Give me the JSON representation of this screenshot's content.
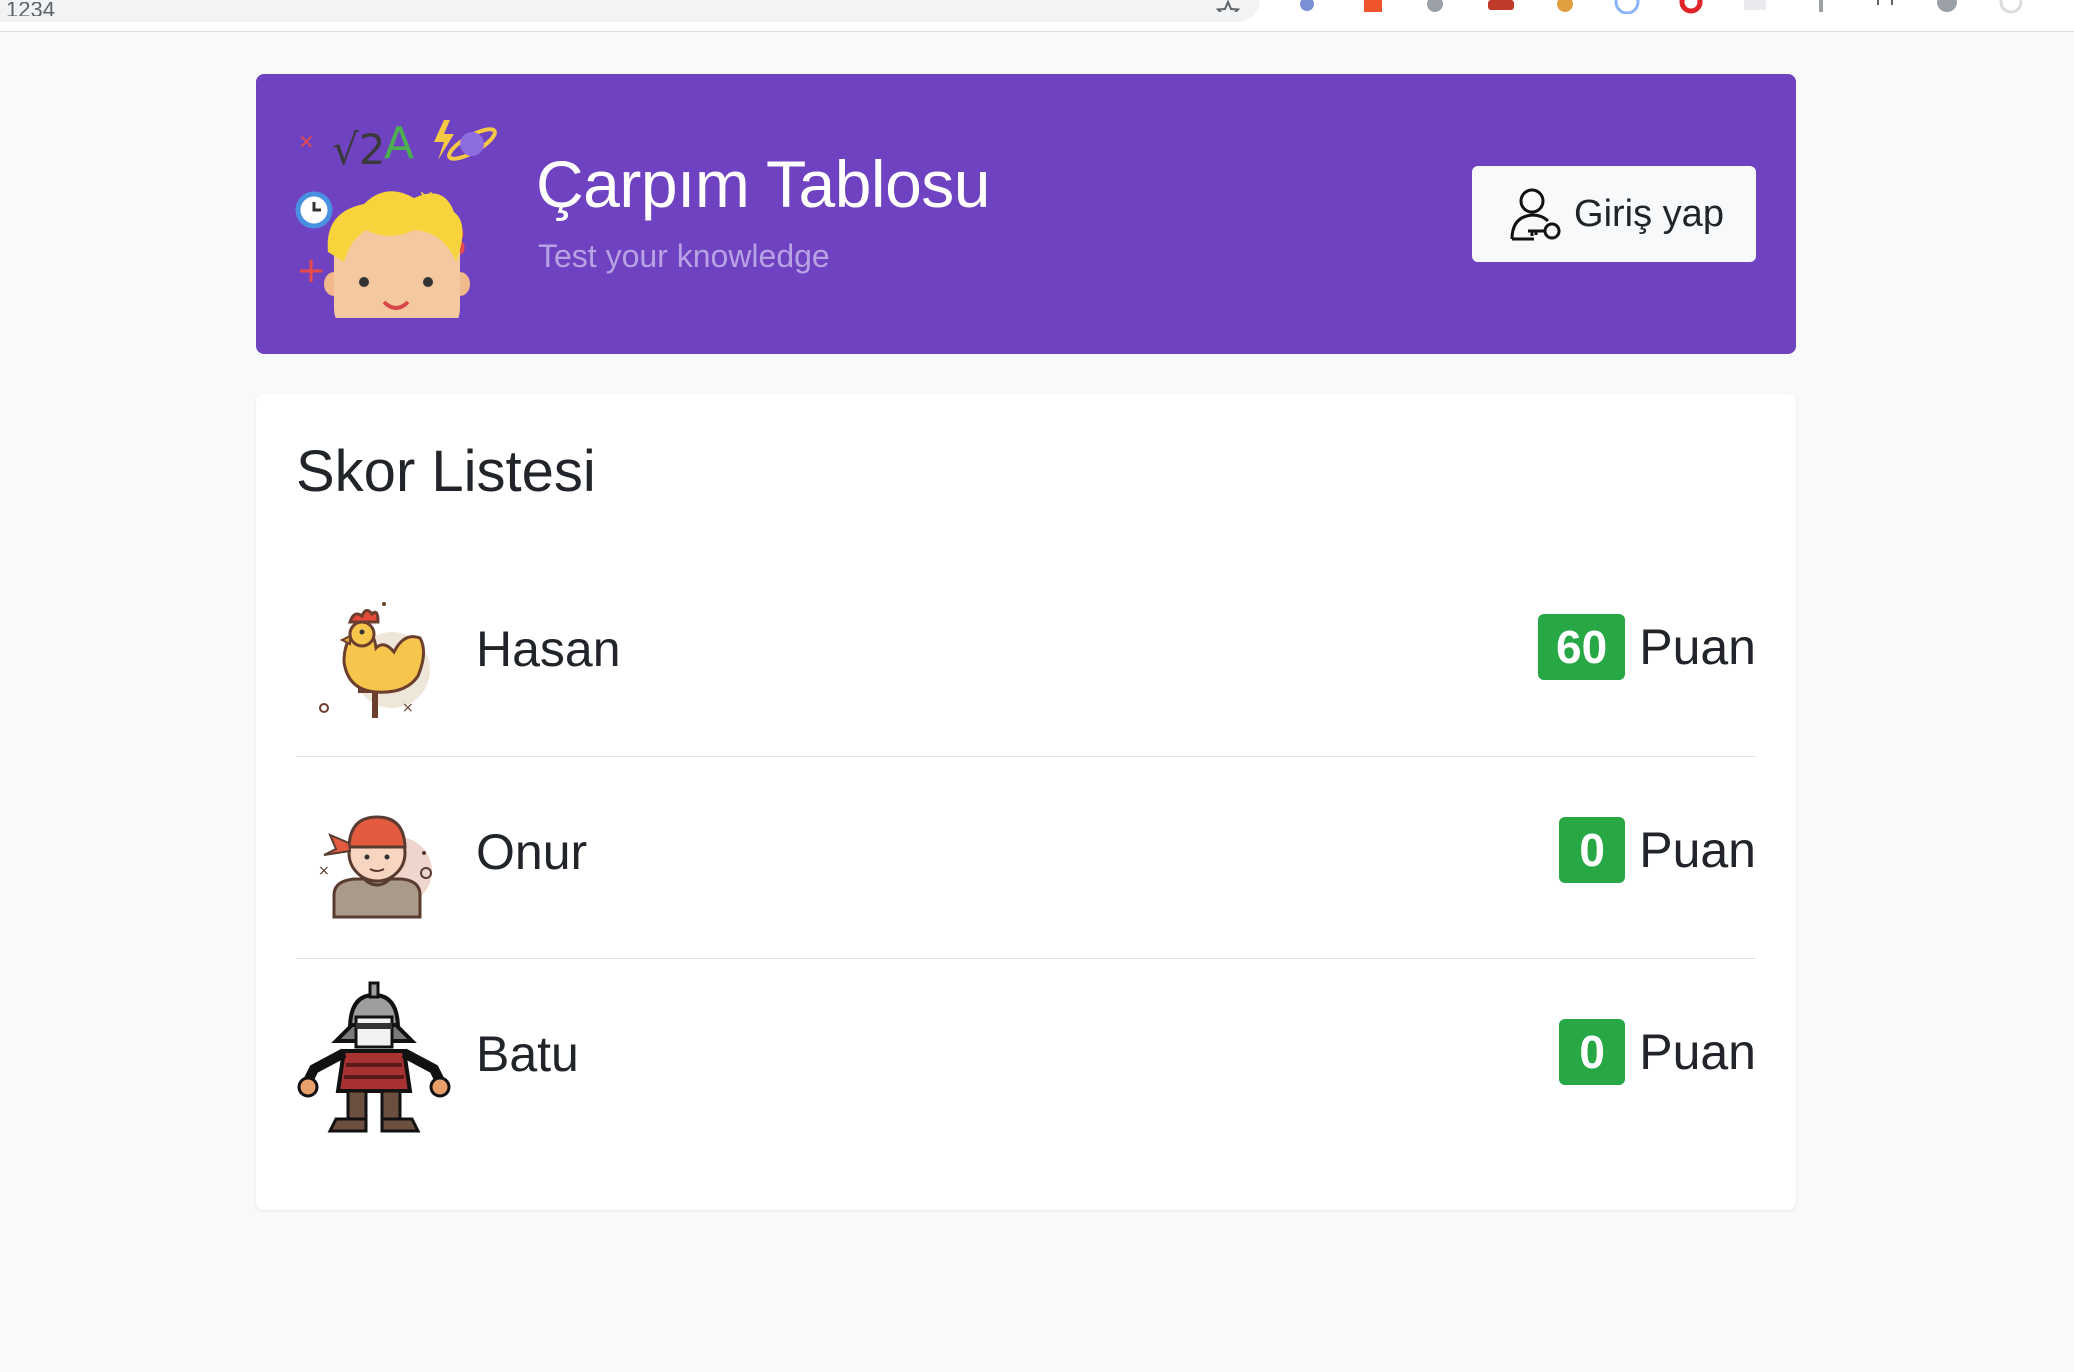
{
  "browser": {
    "url_fragment": "1234"
  },
  "header": {
    "title": "Çarpım Tablosu",
    "subtitle": "Test your knowledge",
    "login_label": "Giriş yap",
    "background_color": "#6f42c1"
  },
  "scoreboard": {
    "title": "Skor Listesi",
    "unit_label": "Puan",
    "badge_color": "#28a745",
    "players": [
      {
        "name": "Hasan",
        "score": "60",
        "avatar_icon": "rooster-icon"
      },
      {
        "name": "Onur",
        "score": "0",
        "avatar_icon": "bandana-boy-icon"
      },
      {
        "name": "Batu",
        "score": "0",
        "avatar_icon": "samurai-icon"
      }
    ]
  }
}
